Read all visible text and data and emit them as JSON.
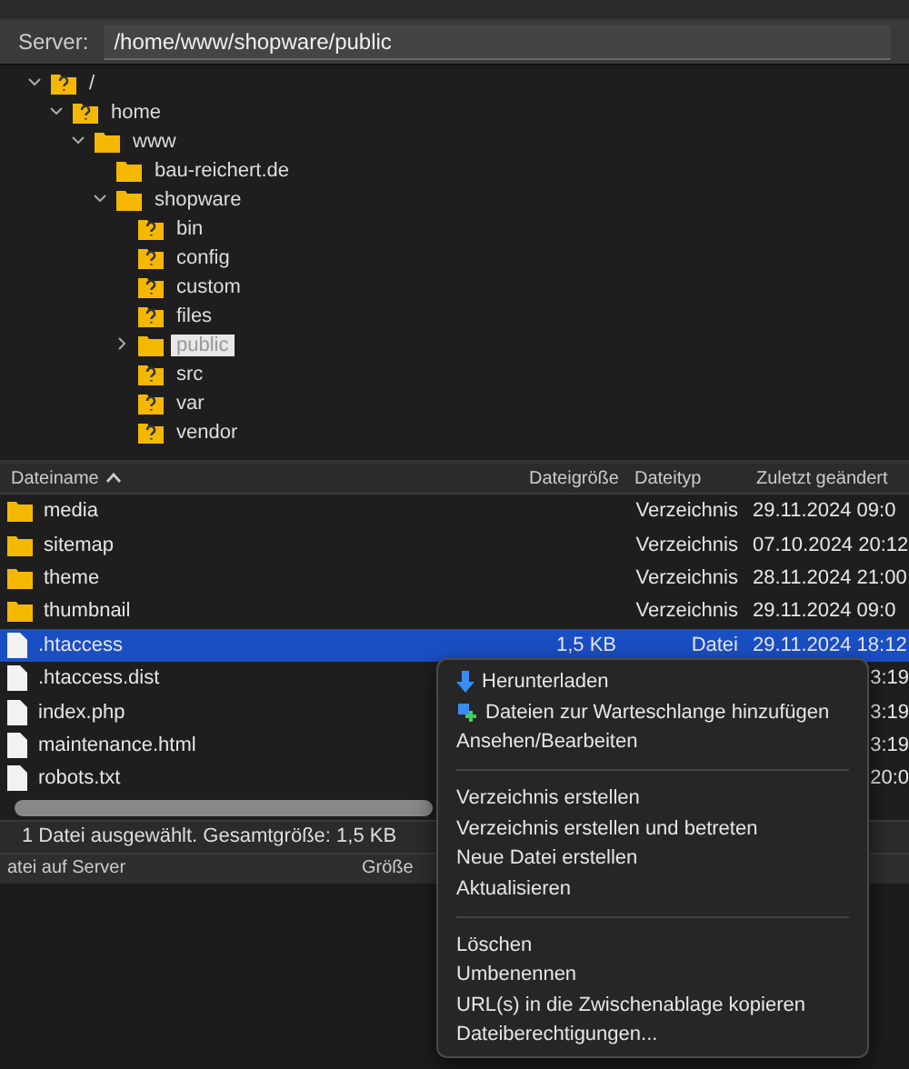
{
  "server_bar": {
    "label": "Server:",
    "path": "/home/www/shopware/public"
  },
  "tree": [
    {
      "name": "/",
      "marked": true,
      "expanded": true,
      "selected": false,
      "children": [
        {
          "name": "home",
          "marked": true,
          "expanded": true,
          "selected": false,
          "children": [
            {
              "name": "www",
              "marked": false,
              "expanded": true,
              "selected": false,
              "children": [
                {
                  "name": "bau-reichert.de",
                  "marked": false,
                  "selected": false
                },
                {
                  "name": "shopware",
                  "marked": false,
                  "expanded": true,
                  "selected": false,
                  "children": [
                    {
                      "name": "bin",
                      "marked": true,
                      "selected": false
                    },
                    {
                      "name": "config",
                      "marked": true,
                      "selected": false
                    },
                    {
                      "name": "custom",
                      "marked": true,
                      "selected": false
                    },
                    {
                      "name": "files",
                      "marked": true,
                      "selected": false
                    },
                    {
                      "name": "public",
                      "marked": false,
                      "expanded": false,
                      "selected": true
                    },
                    {
                      "name": "src",
                      "marked": true,
                      "selected": false
                    },
                    {
                      "name": "var",
                      "marked": true,
                      "selected": false
                    },
                    {
                      "name": "vendor",
                      "marked": true,
                      "selected": false
                    }
                  ]
                }
              ]
            }
          ]
        }
      ]
    }
  ],
  "table": {
    "columns": [
      "Dateiname",
      "Dateigröße",
      "Dateityp",
      "Zuletzt geändert"
    ],
    "rows": [
      {
        "kind": "folder",
        "selected": false,
        "cells": [
          "media",
          "",
          "Verzeichnis",
          "29.11.2024 09:0"
        ]
      },
      {
        "kind": "folder",
        "selected": false,
        "cells": [
          "sitemap",
          "",
          "Verzeichnis",
          "07.10.2024 20:12"
        ]
      },
      {
        "kind": "folder",
        "selected": false,
        "cells": [
          "theme",
          "",
          "Verzeichnis",
          "28.11.2024 21:00"
        ]
      },
      {
        "kind": "folder",
        "selected": false,
        "cells": [
          "thumbnail",
          "",
          "Verzeichnis",
          "29.11.2024 09:0"
        ]
      },
      {
        "kind": "file",
        "selected": true,
        "cells": [
          ".htaccess",
          "1,5 KB",
          "Datei",
          "29.11.2024 18:12"
        ]
      },
      {
        "kind": "file",
        "selected": false,
        "cells": [
          ".htaccess.dist",
          "",
          "",
          "3:19"
        ]
      },
      {
        "kind": "file",
        "selected": false,
        "cells": [
          "index.php",
          "",
          "",
          "3:19"
        ]
      },
      {
        "kind": "file",
        "selected": false,
        "cells": [
          "maintenance.html",
          "",
          "",
          "3:19"
        ]
      },
      {
        "kind": "file",
        "selected": false,
        "cells": [
          "robots.txt",
          "",
          "",
          "20:0"
        ]
      }
    ]
  },
  "status_bar": "1 Datei ausgewählt. Gesamtgröße: 1,5 KB",
  "queue": {
    "columns": [
      "atei auf Server",
      "Größe"
    ]
  },
  "context_menu": [
    {
      "kind": "download",
      "label": "Herunterladen"
    },
    {
      "kind": "enqueue",
      "label": "Dateien zur Warteschlange hinzufügen"
    },
    {
      "kind": "plain",
      "label": "Ansehen/Bearbeiten"
    },
    {
      "kind": "separator"
    },
    {
      "kind": "plain",
      "label": "Verzeichnis erstellen"
    },
    {
      "kind": "plain",
      "label": "Verzeichnis erstellen und betreten"
    },
    {
      "kind": "plain",
      "label": "Neue Datei erstellen"
    },
    {
      "kind": "plain",
      "label": "Aktualisieren"
    },
    {
      "kind": "separator"
    },
    {
      "kind": "plain",
      "label": "Löschen"
    },
    {
      "kind": "plain",
      "label": "Umbenennen"
    },
    {
      "kind": "plain",
      "label": "URL(s) in die Zwischenablage kopieren"
    },
    {
      "kind": "plain",
      "label": "Dateiberechtigungen..."
    }
  ]
}
